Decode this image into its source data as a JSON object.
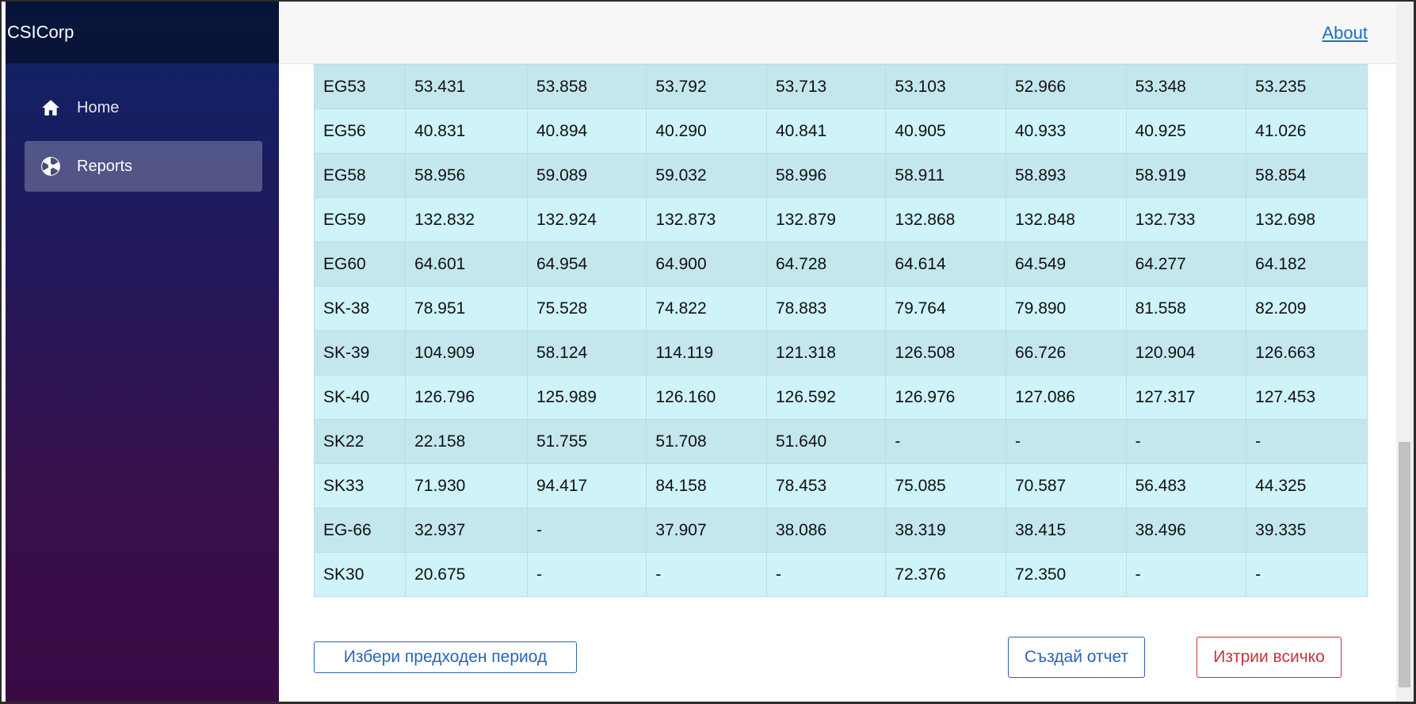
{
  "app": {
    "brand": "CSICorp"
  },
  "sidebar": {
    "items": [
      {
        "label": "Home",
        "icon": "home-icon",
        "active": false
      },
      {
        "label": "Reports",
        "icon": "reports-icon",
        "active": true
      }
    ]
  },
  "topbar": {
    "about_label": "About"
  },
  "table": {
    "rows": [
      [
        "EG53",
        "53.431",
        "53.858",
        "53.792",
        "53.713",
        "53.103",
        "52.966",
        "53.348",
        "53.235"
      ],
      [
        "EG56",
        "40.831",
        "40.894",
        "40.290",
        "40.841",
        "40.905",
        "40.933",
        "40.925",
        "41.026"
      ],
      [
        "EG58",
        "58.956",
        "59.089",
        "59.032",
        "58.996",
        "58.911",
        "58.893",
        "58.919",
        "58.854"
      ],
      [
        "EG59",
        "132.832",
        "132.924",
        "132.873",
        "132.879",
        "132.868",
        "132.848",
        "132.733",
        "132.698"
      ],
      [
        "EG60",
        "64.601",
        "64.954",
        "64.900",
        "64.728",
        "64.614",
        "64.549",
        "64.277",
        "64.182"
      ],
      [
        "SK-38",
        "78.951",
        "75.528",
        "74.822",
        "78.883",
        "79.764",
        "79.890",
        "81.558",
        "82.209"
      ],
      [
        "SK-39",
        "104.909",
        "58.124",
        "114.119",
        "121.318",
        "126.508",
        "66.726",
        "120.904",
        "126.663"
      ],
      [
        "SK-40",
        "126.796",
        "125.989",
        "126.160",
        "126.592",
        "126.976",
        "127.086",
        "127.317",
        "127.453"
      ],
      [
        "SK22",
        "22.158",
        "51.755",
        "51.708",
        "51.640",
        "-",
        "-",
        "-",
        "-"
      ],
      [
        "SK33",
        "71.930",
        "94.417",
        "84.158",
        "78.453",
        "75.085",
        "70.587",
        "56.483",
        "44.325"
      ],
      [
        "EG-66",
        "32.937",
        "-",
        "37.907",
        "38.086",
        "38.319",
        "38.415",
        "38.496",
        "39.335"
      ],
      [
        "SK30",
        "20.675",
        "-",
        "-",
        "-",
        "72.376",
        "72.350",
        "-",
        "-"
      ]
    ]
  },
  "actions": {
    "previous_period_label": "Избери предходен период",
    "create_report_label": "Създай отчет",
    "delete_all_label": "Изтрии всичко"
  },
  "colors": {
    "sidebar_top": "#0c2466",
    "sidebar_bottom": "#3a0a45",
    "row_odd": "#c4e7ee",
    "row_even": "#cef3f9",
    "primary": "#2a64b8",
    "danger": "#c9343e",
    "link": "#1b6ec2"
  }
}
